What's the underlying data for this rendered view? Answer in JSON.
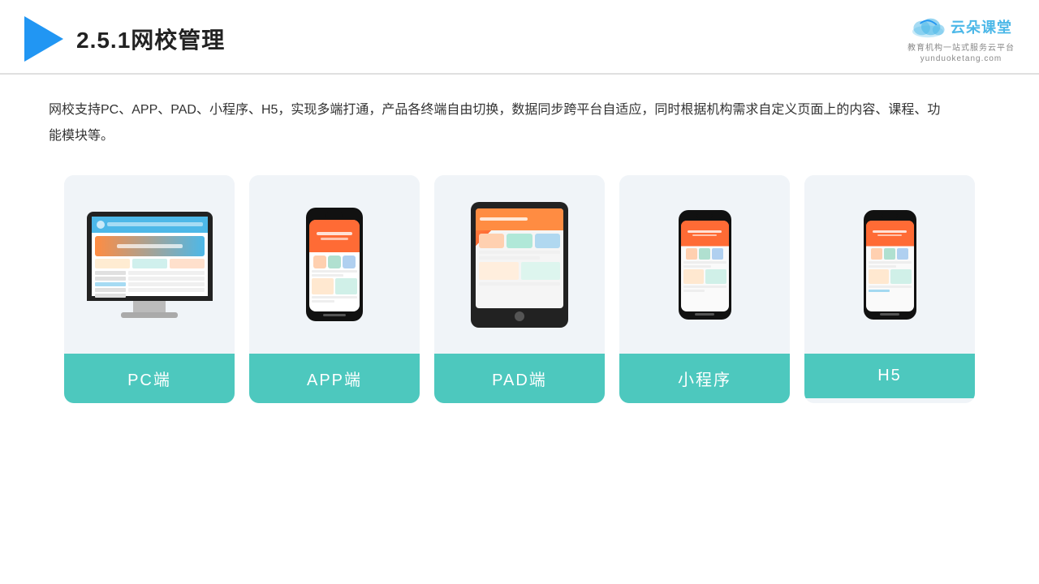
{
  "header": {
    "title": "2.5.1网校管理",
    "brand": {
      "name": "云朵课堂",
      "pinyin": "yunduoketang.com",
      "tagline": "教育机构一站\n式服务云平台"
    }
  },
  "description": "网校支持PC、APP、PAD、小程序、H5，实现多端打通，产品各终端自由切换，数据同步跨平台自适应，同时根据机构需求自定义页面上的内容、课程、功能模块等。",
  "cards": [
    {
      "id": "pc",
      "label": "PC端"
    },
    {
      "id": "app",
      "label": "APP端"
    },
    {
      "id": "pad",
      "label": "PAD端"
    },
    {
      "id": "miniprogram",
      "label": "小程序"
    },
    {
      "id": "h5",
      "label": "H5"
    }
  ],
  "colors": {
    "card_bg": "#f0f4f8",
    "card_label_bg": "#4dc8be",
    "header_line": "#e0e0e0",
    "triangle": "#2196f3",
    "brand_color": "#4db8e8"
  }
}
